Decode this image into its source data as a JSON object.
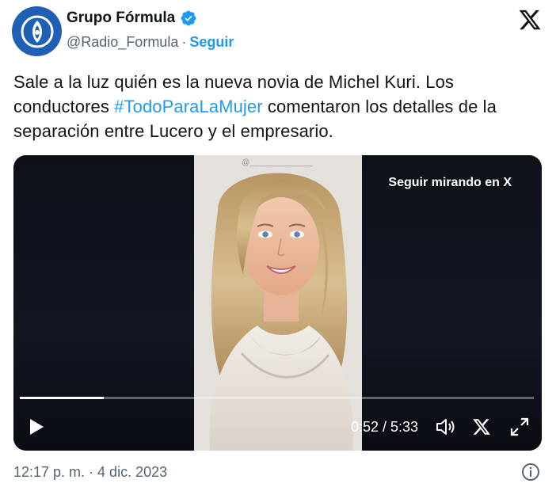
{
  "author": {
    "display_name": "Grupo Fórmula",
    "handle": "@Radio_Formula",
    "separator": "·",
    "follow_label": "Seguir",
    "verified": true,
    "avatar_icon": "grupo-formula-logo",
    "avatar_color": "#1f5fb4"
  },
  "tweet": {
    "text_before": "Sale a la luz quién es la nueva novia de Michel Kuri. Los conductores ",
    "hashtag": "#TodoParaLaMujer",
    "text_after": " comentaron los detalles de la separación entre Lucero y el empresario."
  },
  "video": {
    "watch_label": "Seguir mirando en X",
    "watermark": "@_____________",
    "time_display": "0:52 / 5:33",
    "progress": 0.1627
  },
  "footer": {
    "timestamp": "12:17 p. m. · 4 dic. 2023"
  },
  "colors": {
    "link": "#1d9bf0",
    "text": "#0f1419",
    "muted": "#536471"
  }
}
